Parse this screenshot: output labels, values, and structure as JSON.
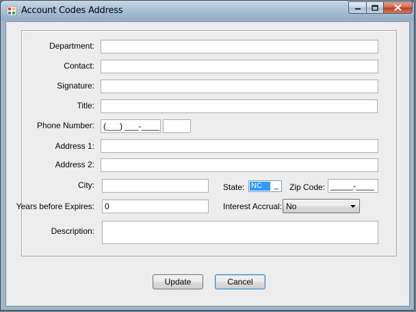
{
  "window": {
    "title": "Account Codes Address",
    "colors": {
      "accent": "#3399ff",
      "titlebar": "#a9c0d6",
      "close": "#c0391c"
    }
  },
  "form": {
    "department_label": "Department:",
    "department_value": "",
    "contact_label": "Contact:",
    "contact_value": "",
    "signature_label": "Signature:",
    "signature_value": "",
    "title_label": "Title:",
    "title_value": "",
    "phone_label": "Phone Number:",
    "phone_mask": "(___) ___-____",
    "phone_ext_value": "",
    "address1_label": "Address 1:",
    "address1_value": "",
    "address2_label": "Address 2:",
    "address2_value": "",
    "city_label": "City:",
    "city_value": "",
    "state_label": "State:",
    "state_value": "NC",
    "state_tail": "_",
    "zip_label": "Zip Code:",
    "zip_mask": "_____-____",
    "years_label": "Years before Expires:",
    "years_value": "0",
    "interest_label": "Interest Accrual:",
    "interest_value": "No",
    "description_label": "Description:",
    "description_value": ""
  },
  "buttons": {
    "update_label": "Update",
    "cancel_label": "Cancel"
  },
  "icons": {
    "app": "app-icon",
    "minimize": "minimize-icon",
    "maximize": "maximize-icon",
    "close": "close-icon",
    "dropdown": "chevron-down-icon"
  }
}
